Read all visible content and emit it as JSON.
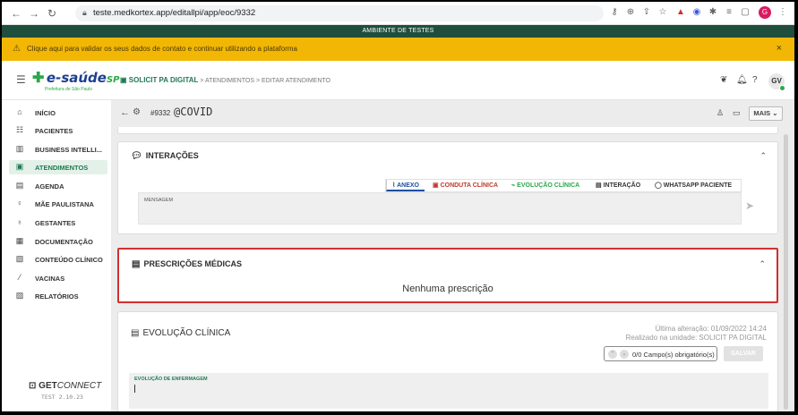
{
  "browser": {
    "url": "teste.medkortex.app/editallpi/app/eoc/9332",
    "profile_initial": "G"
  },
  "env_banner": "AMBIENTE DE TESTES",
  "alert": {
    "text": "Clique aqui para validar os seus dados de contato e continuar utilizando a plataforma",
    "close": "×"
  },
  "header": {
    "logo_text": "e-saúde",
    "logo_suffix": "SP",
    "logo_sub": "Prefeitura de São Paulo",
    "breadcrumb_first": "SOLICIT PA DIGITAL",
    "breadcrumb_2": "ATENDIMENTOS",
    "breadcrumb_3": "EDITAR ATENDIMENTO",
    "separator": ">",
    "avatar": "GV"
  },
  "sidebar": {
    "items": [
      {
        "label": "INÍCIO",
        "icon": "home-icon"
      },
      {
        "label": "PACIENTES",
        "icon": "people-icon"
      },
      {
        "label": "BUSINESS INTELLI...",
        "icon": "chart-icon"
      },
      {
        "label": "ATENDIMENTOS",
        "icon": "clipboard-icon"
      },
      {
        "label": "AGENDA",
        "icon": "calendar-icon"
      },
      {
        "label": "MÃE PAULISTANA",
        "icon": "mother-icon"
      },
      {
        "label": "GESTANTES",
        "icon": "baby-icon"
      },
      {
        "label": "DOCUMENTAÇÃO",
        "icon": "document-icon"
      },
      {
        "label": "CONTEÚDO CLÍNICO",
        "icon": "book-icon"
      },
      {
        "label": "VACINAS",
        "icon": "syringe-icon"
      },
      {
        "label": "RELATÓRIOS",
        "icon": "report-icon"
      }
    ],
    "active_index": 3,
    "footer_logo_bold": "GET",
    "footer_logo_light": "CONNECT",
    "footer_version": "TEST 2.10.23"
  },
  "main": {
    "attendance_number": "#9332",
    "attendance_tag": "@COVID",
    "more_button": "MAIS",
    "interactions": {
      "title": "INTERAÇÕES",
      "tabs": {
        "anexo": "ANEXO",
        "conduta": "CONDUTA CLÍNICA",
        "evolucao": "EVOLUÇÃO CLÍNICA",
        "interacao": "INTERAÇÃO",
        "whatsapp": "WHATSAPP PACIENTE"
      },
      "message_label": "MENSAGEM"
    },
    "prescriptions": {
      "title": "PRESCRIÇÕES MÉDICAS",
      "empty": "Nenhuma prescrição"
    },
    "evolution": {
      "title": "EVOLUÇÃO CLÍNICA",
      "last_change": "Última alteração: 01/09/2022 14:24",
      "unit": "Realizado na unidade: SOLICIT PA DIGITAL",
      "required": "0/0 Campo(s) obrigatório(s)",
      "save": "SALVAR",
      "field_label": "EVOLUÇÃO DE ENFERMAGEM"
    }
  },
  "colors": {
    "brand_green": "#1e7a53",
    "env_banner": "#1f4e3d",
    "alert_yellow": "#f2b705",
    "highlight_red": "#d32f2f"
  }
}
